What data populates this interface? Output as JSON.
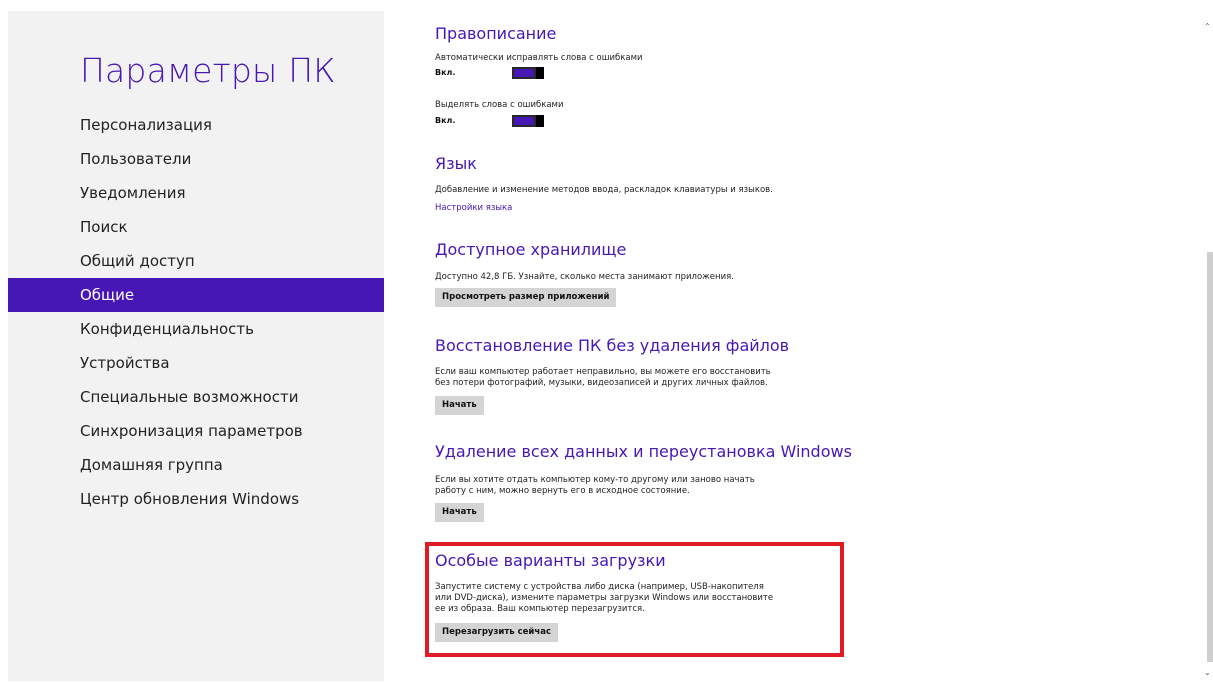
{
  "sidebar": {
    "title": "Параметры ПК",
    "items": [
      {
        "label": "Персонализация"
      },
      {
        "label": "Пользователи"
      },
      {
        "label": "Уведомления"
      },
      {
        "label": "Поиск"
      },
      {
        "label": "Общий доступ"
      },
      {
        "label": "Общие",
        "selected": true
      },
      {
        "label": "Конфиденциальность"
      },
      {
        "label": "Устройства"
      },
      {
        "label": "Специальные возможности"
      },
      {
        "label": "Синхронизация параметров"
      },
      {
        "label": "Домашняя группа"
      },
      {
        "label": "Центр обновления Windows"
      }
    ]
  },
  "spelling": {
    "title": "Правописание",
    "autocorrect_label": "Автоматически исправлять слова с ошибками",
    "autocorrect_state": "Вкл.",
    "highlight_label": "Выделять слова с ошибками",
    "highlight_state": "Вкл."
  },
  "language": {
    "title": "Язык",
    "desc": "Добавление и изменение методов ввода, раскладок клавиатуры и языков.",
    "link": "Настройки языка"
  },
  "storage": {
    "title": "Доступное хранилище",
    "desc": "Доступно 42,8 ГБ. Узнайте, сколько места занимают приложения.",
    "button": "Просмотреть размер приложений"
  },
  "refresh": {
    "title": "Восстановление ПК без удаления файлов",
    "desc": "Если ваш компьютер работает неправильно, вы можете его восстановить без потери фотографий, музыки, видеозаписей и других личных файлов.",
    "button": "Начать"
  },
  "reset": {
    "title": "Удаление всех данных и переустановка Windows",
    "desc": "Если вы хотите отдать компьютер кому-то другому или заново начать работу с ним, можно вернуть его в исходное состояние.",
    "button": "Начать"
  },
  "advanced_startup": {
    "title": "Особые варианты загрузки",
    "desc": "Запустите систему с устройства либо диска (например, USB-накопителя или DVD-диска), измените параметры загрузки Windows или восстановите ее из образа. Ваш компьютер перезагрузится.",
    "button": "Перезагрузить сейчас"
  },
  "colors": {
    "accent": "#4617b4",
    "highlight_border": "#e01b24"
  }
}
